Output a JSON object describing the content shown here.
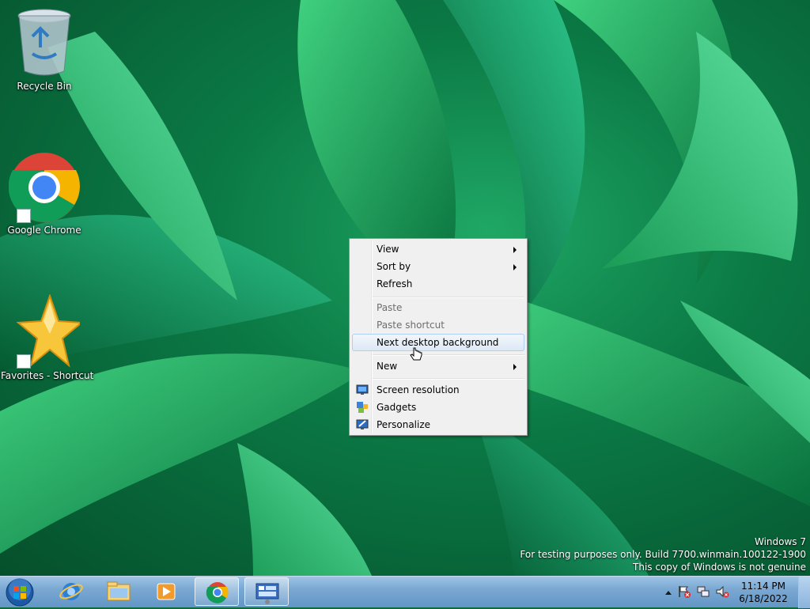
{
  "desktop": {
    "icons": [
      {
        "label": "Recycle Bin",
        "icon": "recycle-bin-icon"
      },
      {
        "label": "Google Chrome",
        "icon": "chrome-icon"
      },
      {
        "label": "Favorites - Shortcut",
        "icon": "star-icon"
      }
    ]
  },
  "context_menu": {
    "items": [
      {
        "label": "View",
        "submenu": true,
        "enabled": true
      },
      {
        "label": "Sort by",
        "submenu": true,
        "enabled": true
      },
      {
        "label": "Refresh",
        "enabled": true
      },
      {
        "label": "Paste",
        "enabled": false
      },
      {
        "label": "Paste shortcut",
        "enabled": false
      },
      {
        "label": "Next desktop background",
        "enabled": true,
        "highlighted": true
      },
      {
        "label": "New",
        "submenu": true,
        "enabled": true
      },
      {
        "label": "Screen resolution",
        "icon": "screen-resolution-icon",
        "enabled": true
      },
      {
        "label": "Gadgets",
        "icon": "gadgets-icon",
        "enabled": true
      },
      {
        "label": "Personalize",
        "icon": "personalize-icon",
        "enabled": true
      }
    ]
  },
  "watermark": {
    "line1": "Windows 7",
    "line2": "For testing purposes only. Build 7700.winmain.100122-1900",
    "line3": "This copy of Windows is not genuine"
  },
  "taskbar": {
    "pinned": [
      "internet-explorer-icon",
      "windows-explorer-icon",
      "media-player-icon",
      "chrome-icon",
      "control-panel-icon"
    ],
    "clock": {
      "time": "11:14 PM",
      "date": "6/18/2022"
    },
    "tray_icons": [
      "show-hidden-icons-chevron",
      "action-center-flag-icon",
      "network-icon",
      "volume-muted-icon"
    ]
  },
  "colors": {
    "taskbar": "#7aa8d2",
    "menu_background": "#f0f0f0",
    "menu_highlight_border": "#aecff7"
  }
}
